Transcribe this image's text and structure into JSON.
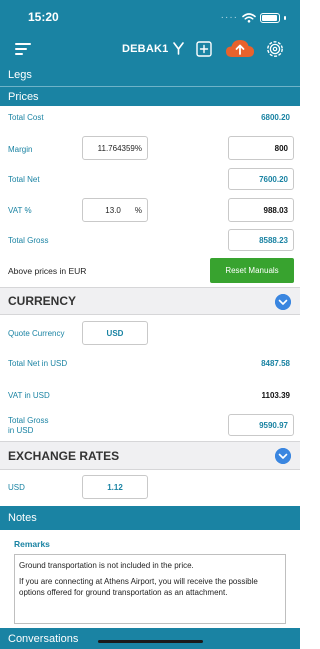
{
  "status_bar": {
    "time": "15:20"
  },
  "nav": {
    "title": "DEBAK1"
  },
  "sections": {
    "legs": "Legs",
    "prices": "Prices",
    "currency": "CURRENCY",
    "exchange_rates": "EXCHANGE RATES",
    "notes": "Notes",
    "conversations": "Conversations"
  },
  "prices": {
    "total_cost_label": "Total Cost",
    "total_cost_value": "6800.20",
    "margin_label": "Margin",
    "margin_percent": "11.764359%",
    "margin_value": "800",
    "total_net_label": "Total Net",
    "total_net_value": "7600.20",
    "vat_label": "VAT %",
    "vat_percent": "13.0",
    "vat_percent_sign": "%",
    "vat_value": "988.03",
    "total_gross_label": "Total Gross",
    "total_gross_value": "8588.23",
    "currency_note": "Above prices in EUR",
    "reset_button": "Reset Manuals"
  },
  "currency": {
    "quote_currency_label": "Quote Currency",
    "quote_currency_value": "USD",
    "total_net_usd_label": "Total Net in USD",
    "total_net_usd_value": "8487.58",
    "vat_usd_label": "VAT in USD",
    "vat_usd_value": "1103.39",
    "total_gross_usd_label_line1": "Total Gross",
    "total_gross_usd_label_line2": "in USD",
    "total_gross_usd_value": "9590.97"
  },
  "exchange_rates": {
    "currency_label": "USD",
    "rate_value": "1.12"
  },
  "notes": {
    "remarks_label": "Remarks",
    "remarks_line1": "Ground transportation is not included in the price.",
    "remarks_line2": "If you are connecting at Athens Airport, you will receive the possible options offered for ground transportation as an attachment."
  },
  "colors": {
    "brand_teal": "#1a83a3",
    "cloud_orange": "#e8622c",
    "reset_green": "#38a32f",
    "chevron_blue": "#3a86e0"
  },
  "icons": [
    "menu-icon",
    "fork-icon",
    "add-square-icon",
    "cloud-upload-icon",
    "settings-gear-icon",
    "chevron-down-icon",
    "wifi-icon",
    "battery-icon"
  ]
}
